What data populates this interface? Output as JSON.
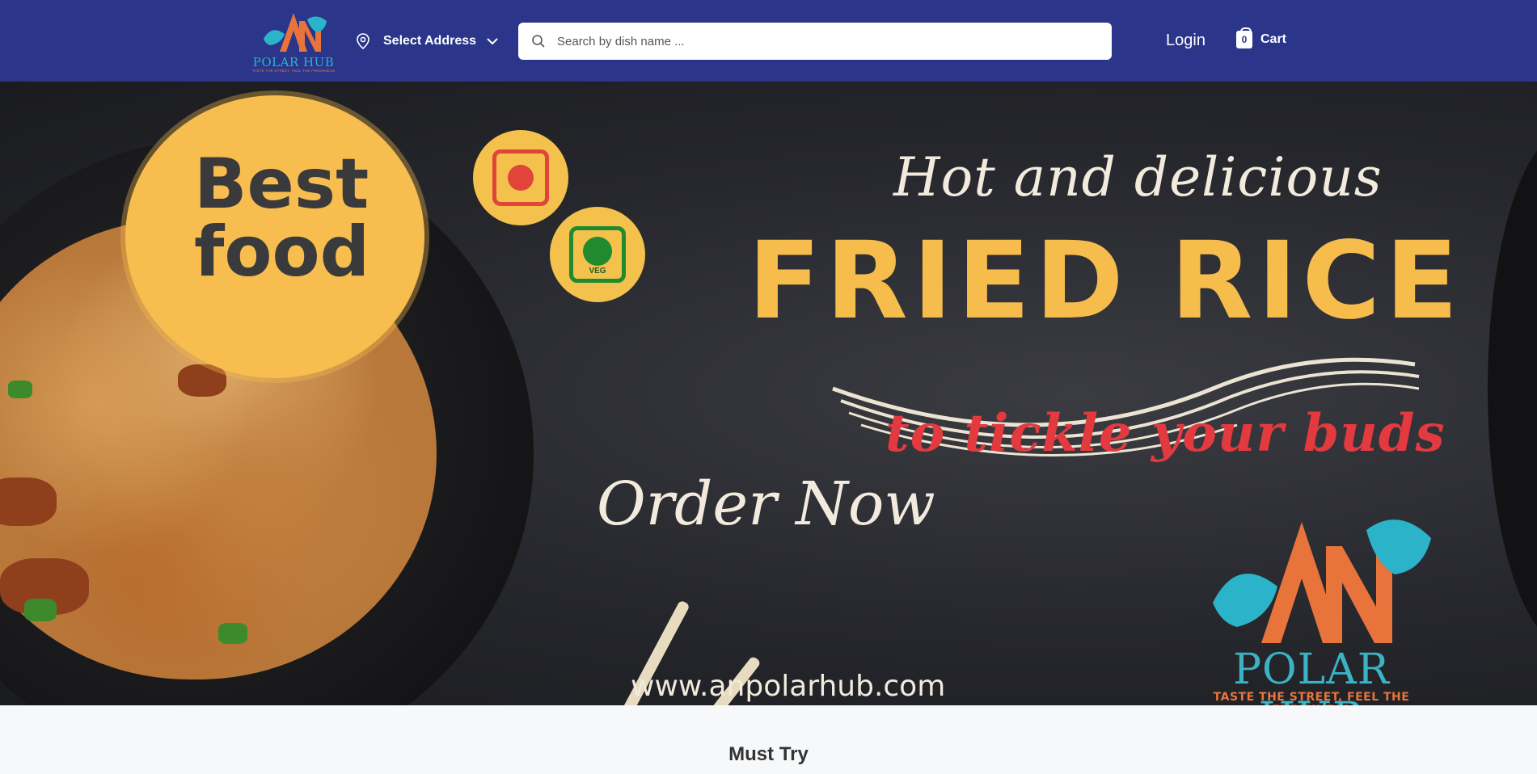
{
  "header": {
    "logo_text": "POLAR HUB",
    "logo_tagline": "TASTE THE STREET, FEEL THE FRESHNESS",
    "address_label": "Select Address",
    "search_placeholder": "Search by dish name ...",
    "login_label": "Login",
    "cart_count": "0",
    "cart_label": "Cart"
  },
  "banner": {
    "badge_line1": "Best",
    "badge_line2": "food",
    "veg_label": "VEG",
    "headline_top": "Hot and delicious",
    "headline_main": "FRIED RICE",
    "headline_sub": "to tickle your buds",
    "cta": "Order Now",
    "website": "www.anpolarhub.com",
    "brand_name": "POLAR HUB",
    "brand_tagline": "TASTE THE STREET, FEEL THE FRESHNESS"
  },
  "sections": {
    "must_try_title": "Must Try"
  },
  "colors": {
    "header_bg": "#2b3589",
    "accent_yellow": "#f6bd4c",
    "accent_red": "#e23a3f",
    "accent_teal": "#3bb3c4",
    "accent_orange": "#e8743b"
  },
  "icons": [
    "location-pin-icon",
    "chevron-down-icon",
    "search-icon",
    "shopping-bag-icon"
  ]
}
